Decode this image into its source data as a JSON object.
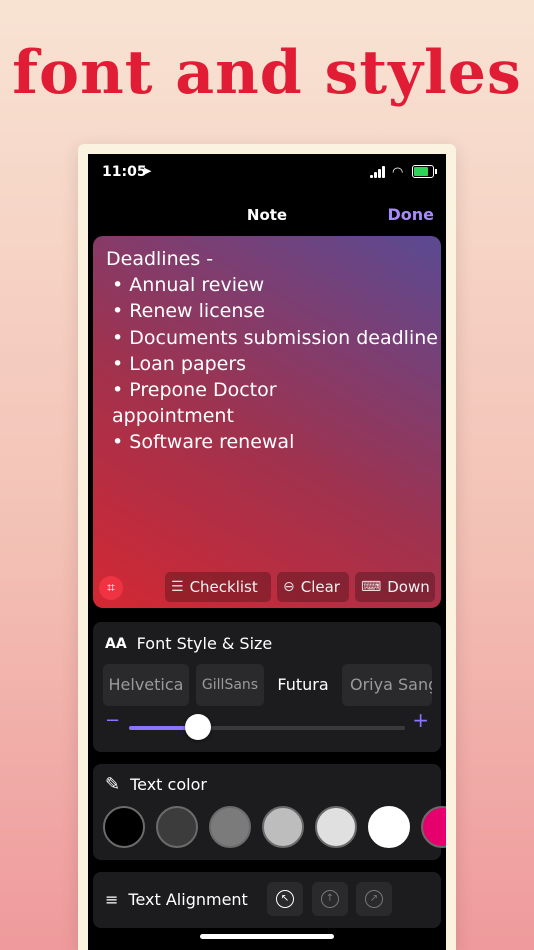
{
  "headline": "font and styles",
  "status": {
    "time": "11:05"
  },
  "nav": {
    "title": "Note",
    "done": "Done"
  },
  "note": {
    "lines": [
      "Deadlines -",
      " • Annual review",
      " • Renew license",
      " • Documents submission deadline",
      " • Loan papers",
      " • Prepone Doctor",
      " appointment",
      " • Software renewal"
    ],
    "buttons": {
      "checklist": "Checklist",
      "clear": "Clear",
      "down": "Down"
    }
  },
  "font_panel": {
    "icon_text": "AA",
    "title": "Font Style & Size",
    "fonts": [
      "Helvetica",
      "GillSans",
      "Futura",
      "Oriya Sangam MN"
    ],
    "selected_font": "Futura",
    "size_level": 0.25
  },
  "color_panel": {
    "title": "Text color",
    "colors": [
      "#000000",
      "#3c3c3c",
      "#7b7b7b",
      "#bdbdbd",
      "#e0e0e0",
      "#ffffff",
      "#e6006e"
    ]
  },
  "alignment_panel": {
    "title": "Text Alignment",
    "options": [
      "left",
      "center",
      "right"
    ],
    "selected": "left"
  }
}
